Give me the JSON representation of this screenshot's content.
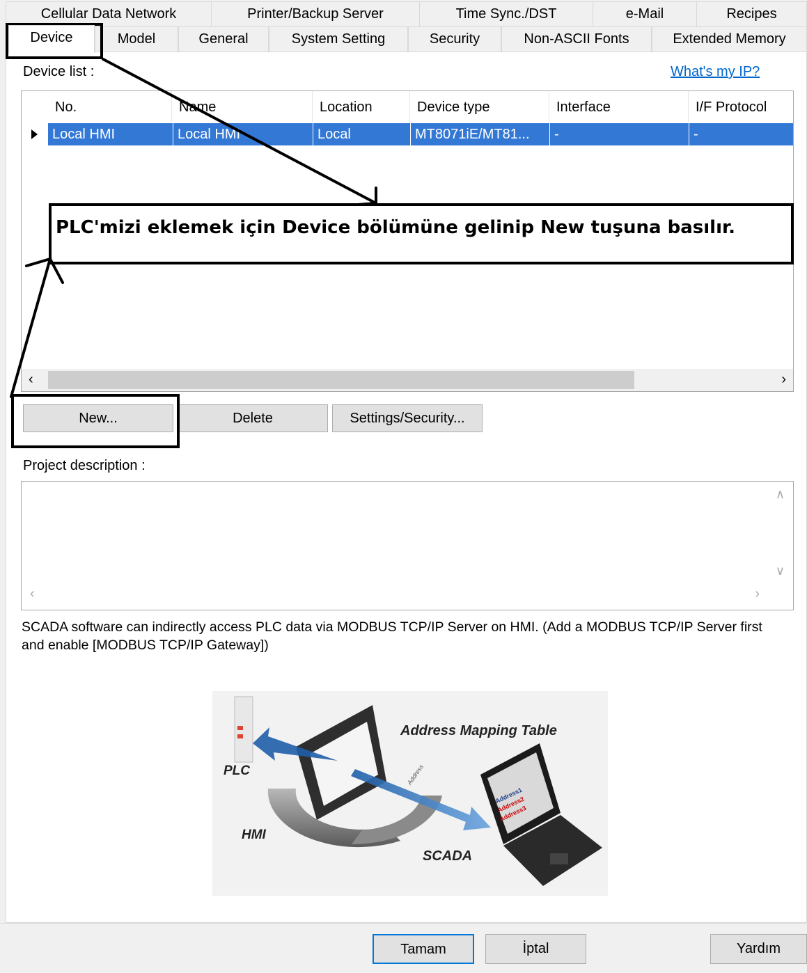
{
  "tabs_row1": [
    "Cellular Data Network",
    "Printer/Backup Server",
    "Time Sync./DST",
    "e-Mail",
    "Recipes"
  ],
  "tabs_row2": [
    "Device",
    "Model",
    "General",
    "System Setting",
    "Security",
    "Non-ASCII Fonts",
    "Extended Memory"
  ],
  "device_list_label": "Device list :",
  "whats_my_ip": "What's my IP?",
  "table": {
    "columns": [
      "No.",
      "Name",
      "Location",
      "Device type",
      "Interface",
      "I/F Protocol"
    ],
    "rows": [
      [
        "Local HMI",
        "Local HMI",
        "Local",
        "MT8071iE/MT81...",
        "-",
        "-"
      ]
    ]
  },
  "annotation_text": "PLC'mizi eklemek için Device bölümüne gelinip New tuşuna basılır.",
  "buttons": {
    "new": "New...",
    "delete": "Delete",
    "settings": "Settings/Security..."
  },
  "project_description_label": "Project description :",
  "scada_note": "SCADA software can indirectly access PLC data via MODBUS TCP/IP Server on HMI. (Add a MODBUS TCP/IP Server first and enable [MODBUS TCP/IP Gateway])",
  "diagram": {
    "title": "Address Mapping Table",
    "plc": "PLC",
    "hmi": "HMI",
    "scada": "SCADA",
    "address": "Address",
    "screen_lines": [
      "Address1",
      "Address2",
      "Address3"
    ]
  },
  "footer": {
    "ok": "Tamam",
    "cancel": "İptal",
    "help": "Yardım"
  },
  "colors": {
    "selection": "#3478d6",
    "link": "#0066cc",
    "arrow": "#2a6db8"
  }
}
